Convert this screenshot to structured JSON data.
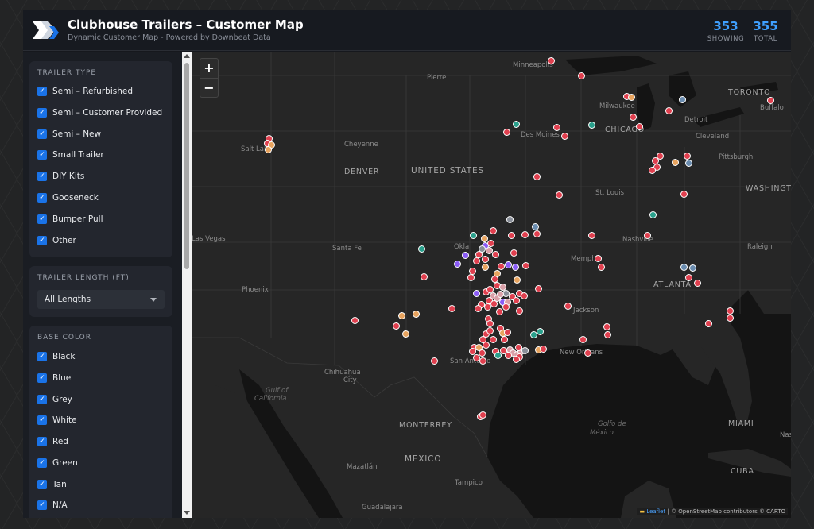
{
  "header": {
    "title": "Clubhouse Trailers – Customer Map",
    "subtitle": "Dynamic Customer Map - Powered by Downbeat Data",
    "showing_count": "353",
    "showing_label": "SHOWING",
    "total_count": "355",
    "total_label": "TOTAL",
    "accent_color": "#3fa0ff"
  },
  "filters": {
    "trailer_type": {
      "title": "TRAILER TYPE",
      "options": [
        {
          "label": "Semi – Refurbished",
          "checked": true
        },
        {
          "label": "Semi – Customer Provided",
          "checked": true
        },
        {
          "label": "Semi – New",
          "checked": true
        },
        {
          "label": "Small Trailer",
          "checked": true
        },
        {
          "label": "DIY Kits",
          "checked": true
        },
        {
          "label": "Gooseneck",
          "checked": true
        },
        {
          "label": "Bumper Pull",
          "checked": true
        },
        {
          "label": "Other",
          "checked": true
        }
      ]
    },
    "trailer_length": {
      "title": "TRAILER LENGTH (FT)",
      "selected": "All Lengths"
    },
    "base_color": {
      "title": "BASE COLOR",
      "options": [
        {
          "label": "Black",
          "checked": true
        },
        {
          "label": "Blue",
          "checked": true
        },
        {
          "label": "Grey",
          "checked": true
        },
        {
          "label": "White",
          "checked": true
        },
        {
          "label": "Red",
          "checked": true
        },
        {
          "label": "Green",
          "checked": true
        },
        {
          "label": "Tan",
          "checked": true
        },
        {
          "label": "N/A",
          "checked": true
        }
      ]
    }
  },
  "map": {
    "zoom_in": "+",
    "zoom_out": "−",
    "attribution_link": "Leaflet",
    "attribution_text": " | © OpenStreetMap contributors © CARTO",
    "labels": {
      "minneapolis": "Minneapolis",
      "pierre": "Pierre",
      "toronto": "TORONTO",
      "milwaukee": "Milwaukee",
      "detroit": "Detroit",
      "buffalo": "Buffalo",
      "salt_lake": "Salt Lake",
      "des_moines": "Des Moines",
      "chicago": "CHICAGO",
      "cleveland": "Cleveland",
      "cheyenne": "Cheyenne",
      "pittsburgh": "Pittsburgh",
      "denver": "DENVER",
      "united_states": "UNITED STATES",
      "st_louis": "St. Louis",
      "washington": "WASHINGTO",
      "las_vegas": "Las Vegas",
      "oklahoma": "Okla",
      "nashville": "Nashville",
      "raleigh": "Raleigh",
      "santa_fe": "Santa Fe",
      "memphis": "Memphis",
      "atlanta": "ATLANTA",
      "phoenix": "Phoenix",
      "jackson": "Jackson",
      "san_antonio": "San Antonio",
      "new_orleans": "New Orleans",
      "chihuahua": "Chihuahua",
      "chihuahua_state": "City",
      "gulf_ca_1": "Gulf of",
      "gulf_ca_2": "California",
      "monterrey": "MONTERREY",
      "mexico": "MEXICO",
      "golfo_1": "Golfo de",
      "golfo_2": "México",
      "miami": "MIAMI",
      "mazatlan": "Mazatlán",
      "tampico": "Tampico",
      "cuba": "CUBA",
      "guadalajara": "Guadalajara",
      "nassau": "Nas"
    },
    "marker_colors": {
      "red": "#e0404f",
      "tan": "#e8a45f",
      "purple": "#8b5cf6",
      "green": "#2aa08c",
      "blue_grey": "#6a8caf",
      "grey": "#8a8f99",
      "pink": "#d9a0a8"
    }
  }
}
